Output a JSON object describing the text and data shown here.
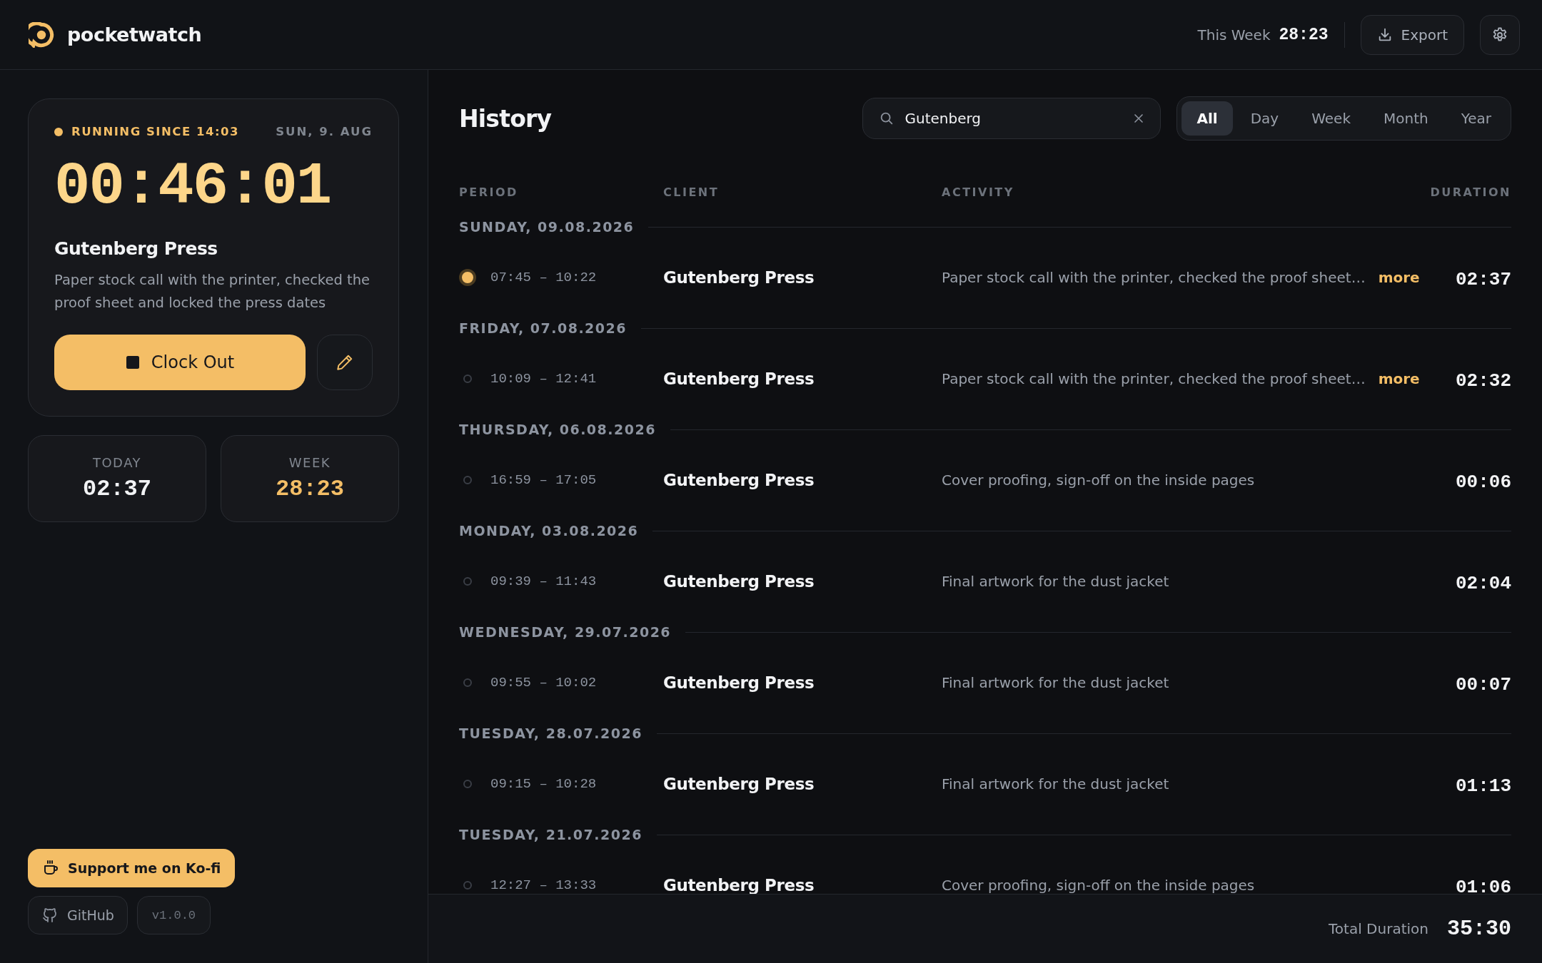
{
  "header": {
    "app_name": "pocketwatch",
    "week_label": "This Week",
    "week_total": "28:23",
    "export_label": "Export"
  },
  "timer": {
    "running_label": "RUNNING SINCE 14:03",
    "date": "SUN, 9. AUG",
    "elapsed": "00:46:01",
    "client": "Gutenberg Press",
    "description": "Paper stock call with the printer, checked the proof sheet and locked the press dates",
    "clock_out_label": "Clock Out"
  },
  "stats": [
    {
      "label": "TODAY",
      "value": "02:37",
      "accent": false
    },
    {
      "label": "WEEK",
      "value": "28:23",
      "accent": true
    }
  ],
  "support_label": "Support me on Ko-fi",
  "github_label": "GitHub",
  "version": "v1.0.0",
  "history": {
    "title": "History",
    "search": {
      "value": "Gutenberg"
    },
    "periods": [
      {
        "label": "All",
        "selected": true
      },
      {
        "label": "Day",
        "selected": false
      },
      {
        "label": "Week",
        "selected": false
      },
      {
        "label": "Month",
        "selected": false
      },
      {
        "label": "Year",
        "selected": false
      }
    ],
    "columns": [
      "PERIOD",
      "CLIENT",
      "ACTIVITY",
      "DURATION"
    ],
    "days": [
      {
        "date": "SUNDAY, 09.08.2026",
        "entries": [
          {
            "period": "07:45 – 10:22",
            "client": "Gutenberg Press",
            "activity": "Paper stock call with the printer, checked the proof sheet…",
            "more_label": "more",
            "duration": "02:37",
            "running": true
          }
        ]
      },
      {
        "date": "FRIDAY, 07.08.2026",
        "entries": [
          {
            "period": "10:09 – 12:41",
            "client": "Gutenberg Press",
            "activity": "Paper stock call with the printer, checked the proof sheet…",
            "more_label": "more",
            "duration": "02:32",
            "running": false
          }
        ]
      },
      {
        "date": "THURSDAY, 06.08.2026",
        "entries": [
          {
            "period": "16:59 – 17:05",
            "client": "Gutenberg Press",
            "activity": "Cover proofing, sign-off on the inside pages",
            "duration": "00:06",
            "running": false
          }
        ]
      },
      {
        "date": "MONDAY, 03.08.2026",
        "entries": [
          {
            "period": "09:39 – 11:43",
            "client": "Gutenberg Press",
            "activity": "Final artwork for the dust jacket",
            "duration": "02:04",
            "running": false
          }
        ]
      },
      {
        "date": "WEDNESDAY, 29.07.2026",
        "entries": [
          {
            "period": "09:55 – 10:02",
            "client": "Gutenberg Press",
            "activity": "Final artwork for the dust jacket",
            "duration": "00:07",
            "running": false
          }
        ]
      },
      {
        "date": "TUESDAY, 28.07.2026",
        "entries": [
          {
            "period": "09:15 – 10:28",
            "client": "Gutenberg Press",
            "activity": "Final artwork for the dust jacket",
            "duration": "01:13",
            "running": false
          }
        ]
      },
      {
        "date": "TUESDAY, 21.07.2026",
        "entries": [
          {
            "period": "12:27 – 13:33",
            "client": "Gutenberg Press",
            "activity": "Cover proofing, sign-off on the inside pages",
            "duration": "01:06",
            "running": false
          }
        ]
      }
    ],
    "total_label": "Total Duration",
    "total": "35:30"
  }
}
